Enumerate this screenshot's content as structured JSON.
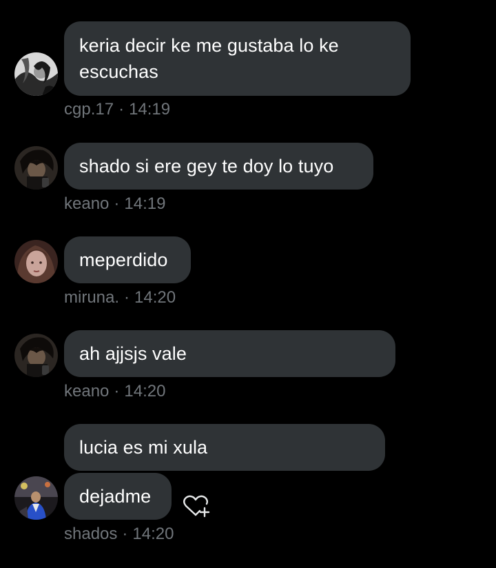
{
  "messages": [
    {
      "text": "keria decir ke me gustaba lo ke escuchas",
      "author": "cgp.17",
      "time": "14:19"
    },
    {
      "text": "shado si ere gey te doy lo tuyo",
      "author": "keano",
      "time": "14:19"
    },
    {
      "text": "meperdido",
      "author": "miruna.",
      "time": "14:20"
    },
    {
      "text": "ah ajjsjs vale",
      "author": "keano",
      "time": "14:20"
    },
    {
      "text": "lucia es mi xula",
      "author": "shados",
      "time": "14:20"
    },
    {
      "text": "dejadme"
    }
  ],
  "separator": "·",
  "icons": {
    "like": "heart-plus-icon"
  },
  "colors": {
    "background": "#000000",
    "bubble": "#2f3336",
    "text": "#ffffff",
    "meta": "#71767b"
  }
}
